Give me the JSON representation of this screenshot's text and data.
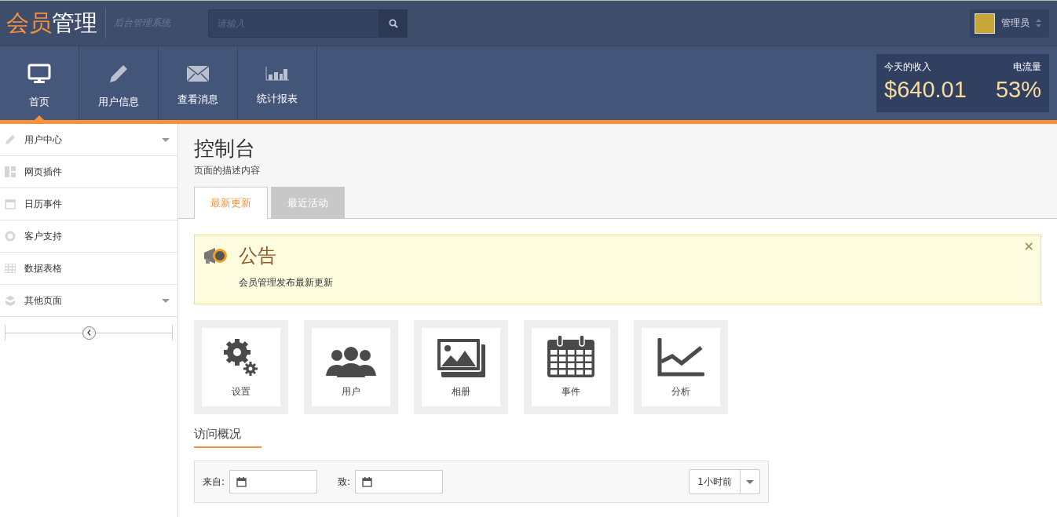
{
  "brand": {
    "accent": "会员",
    "rest": "管理",
    "subtitle": "后台管理系统"
  },
  "search": {
    "placeholder": "请输入"
  },
  "user": {
    "name": "管理员"
  },
  "nav": [
    {
      "label": "首页",
      "kind": "monitor",
      "selected": true
    },
    {
      "label": "用户信息",
      "kind": "pencil",
      "selected": false
    },
    {
      "label": "查看消息",
      "kind": "mail",
      "selected": false
    },
    {
      "label": "统计报表",
      "kind": "bars",
      "selected": false
    }
  ],
  "stats": {
    "income_label": "今天的收入",
    "income": "$640.01",
    "traffic_label": "电流量",
    "traffic": "53%"
  },
  "sidebar": {
    "items": [
      {
        "label": "用户中心",
        "kind": "pencil",
        "expandable": true
      },
      {
        "label": "网页插件",
        "kind": "layout",
        "expandable": false
      },
      {
        "label": "日历事件",
        "kind": "calendar",
        "expandable": false
      },
      {
        "label": "客户支持",
        "kind": "lifebuoy",
        "expandable": false
      },
      {
        "label": "数据表格",
        "kind": "grid",
        "expandable": false
      },
      {
        "label": "其他页面",
        "kind": "box",
        "expandable": true
      }
    ]
  },
  "page": {
    "title": "控制台",
    "description": "页面的描述内容"
  },
  "tabs": [
    {
      "label": "最新更新",
      "selected": true
    },
    {
      "label": "最近活动",
      "selected": false
    }
  ],
  "notice": {
    "title": "公告",
    "text": "会员管理发布最新更新",
    "close": "×"
  },
  "shortcuts": [
    {
      "label": "设置",
      "kind": "gears"
    },
    {
      "label": "用户",
      "kind": "users"
    },
    {
      "label": "相册",
      "kind": "photos"
    },
    {
      "label": "事件",
      "kind": "calendar"
    },
    {
      "label": "分析",
      "kind": "chart"
    }
  ],
  "visits": {
    "heading": "访问概况",
    "from_label": "来自:",
    "to_label": "致:",
    "range": "1小时前"
  }
}
